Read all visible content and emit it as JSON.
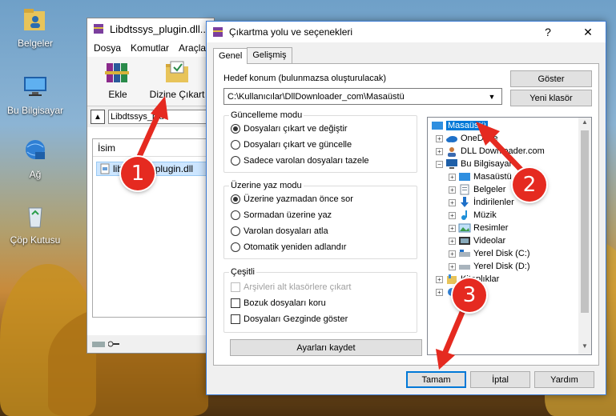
{
  "desktop": {
    "icons": [
      {
        "label": "Belgeler",
        "icon": "folder-user-icon"
      },
      {
        "label": "Bu Bilgisayar",
        "icon": "computer-icon"
      },
      {
        "label": "Ağ",
        "icon": "network-icon"
      },
      {
        "label": "Çöp Kutusu",
        "icon": "recycle-bin-icon"
      }
    ]
  },
  "winrar": {
    "title": "Libdtssys_plugin.dll...",
    "menu": [
      "Dosya",
      "Komutlar",
      "Araçla"
    ],
    "toolbar": {
      "extract_label": "Ekle",
      "extract_to_label": "Dizine Çıkart"
    },
    "address": "Libdtssys_plu",
    "list_header": "İsim",
    "file_name": "libdtssys_plugin.dll"
  },
  "dialog": {
    "title": "Çıkartma yolu ve seçenekleri",
    "help_glyph": "?",
    "close_glyph": "✕",
    "tabs": [
      {
        "label": "Genel"
      },
      {
        "label": "Gelişmiş"
      }
    ],
    "target_label": "Hedef konum (bulunmazsa oluşturulacak)",
    "target_value": "C:\\Kullanıcılar\\DllDownloader_com\\Masaüstü",
    "show_button": "Göster",
    "new_folder_button": "Yeni klasör",
    "update_mode": {
      "legend": "Güncelleme modu",
      "options": [
        "Dosyaları çıkart ve değiştir",
        "Dosyaları çıkart ve güncelle",
        "Sadece varolan dosyaları tazele"
      ],
      "selected": 0
    },
    "overwrite_mode": {
      "legend": "Üzerine yaz modu",
      "options": [
        "Üzerine yazmadan önce sor",
        "Sormadan üzerine yaz",
        "Varolan dosyaları atla",
        "Otomatik yeniden adlandır"
      ],
      "selected": 0
    },
    "misc": {
      "legend": "Çeşitli",
      "options": [
        "Arşivleri alt klasörlere çıkart",
        "Bozuk dosyaları koru",
        "Dosyaları Gezginde göster"
      ]
    },
    "save_settings_button": "Ayarları kaydet",
    "tree": [
      {
        "label": "Masaüstü",
        "icon": "desktop-icon",
        "selected": true
      },
      {
        "label": "OneDrive",
        "icon": "onedrive-icon"
      },
      {
        "label": "DLL Downloader.com",
        "icon": "user-icon"
      },
      {
        "label": "Bu Bilgisayar",
        "icon": "computer-icon"
      },
      {
        "label": "Masaüstü",
        "icon": "desktop-icon"
      },
      {
        "label": "Belgeler",
        "icon": "documents-icon"
      },
      {
        "label": "İndirilenler",
        "icon": "download-icon"
      },
      {
        "label": "Müzik",
        "icon": "music-icon"
      },
      {
        "label": "Resimler",
        "icon": "pictures-icon"
      },
      {
        "label": "Videolar",
        "icon": "videos-icon"
      },
      {
        "label": "Yerel Disk (C:)",
        "icon": "drive-icon"
      },
      {
        "label": "Yerel Disk (D:)",
        "icon": "drive-icon"
      },
      {
        "label": "Kitaplıklar",
        "icon": "libraries-icon"
      },
      {
        "label": "Ağ",
        "icon": "network-icon"
      }
    ],
    "ok_button": "Tamam",
    "cancel_button": "İptal",
    "help_button": "Yardım"
  },
  "annotations": [
    "1",
    "2",
    "3"
  ],
  "colors": {
    "accent": "#0078d7",
    "badge": "#e52a20"
  }
}
